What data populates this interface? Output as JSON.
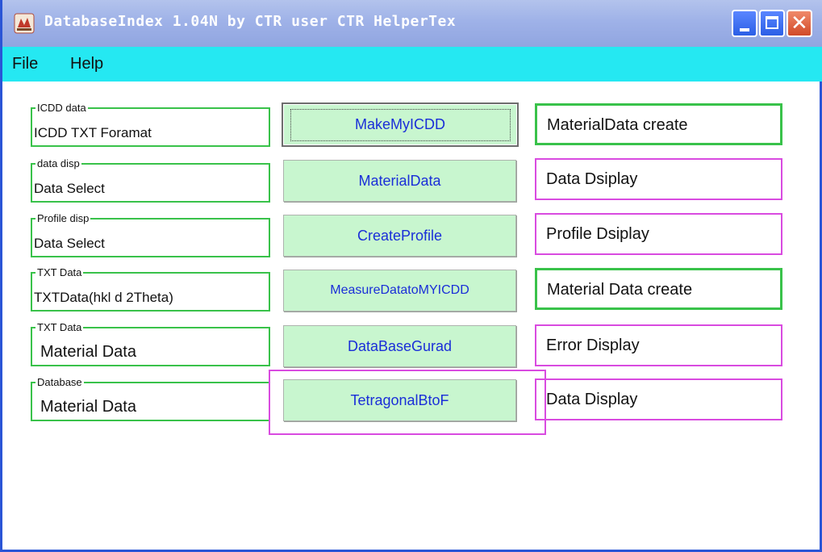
{
  "window": {
    "title": "DatabaseIndex 1.04N by CTR user CTR HelperTex",
    "controls": [
      "minimize-icon",
      "maximize-icon",
      "close-icon"
    ],
    "close_glyph": "✕"
  },
  "menu": {
    "file": "File",
    "help": "Help"
  },
  "groups": [
    {
      "legend": "ICDD data",
      "value": "ICDD TXT Foramat"
    },
    {
      "legend": "data disp",
      "value": "Data Select"
    },
    {
      "legend": "Profile disp",
      "value": "Data Select"
    },
    {
      "legend": "TXT Data",
      "value": "TXTData(hkl d 2Theta)"
    },
    {
      "legend": "TXT Data",
      "value": "Material Data"
    },
    {
      "legend": "Database",
      "value": "Material Data"
    }
  ],
  "buttons": [
    "MakeMyICDD",
    "MaterialData",
    "CreateProfile",
    "MeasureDatatoMYICDD",
    "DataBaseGurad",
    "TetragonalBtoF"
  ],
  "descriptions": [
    "MaterialData create",
    "Data Dsiplay",
    "Profile Dsiplay",
    "Material Data create",
    "Error Display",
    "Data Display"
  ],
  "colors": {
    "titlebar": "#9fb2e8",
    "menubar": "#25e8f2",
    "button_bg": "#c8f6cf",
    "button_text": "#1a2ed8",
    "green_border": "#39c24a",
    "magenta_border": "#d94be0"
  }
}
